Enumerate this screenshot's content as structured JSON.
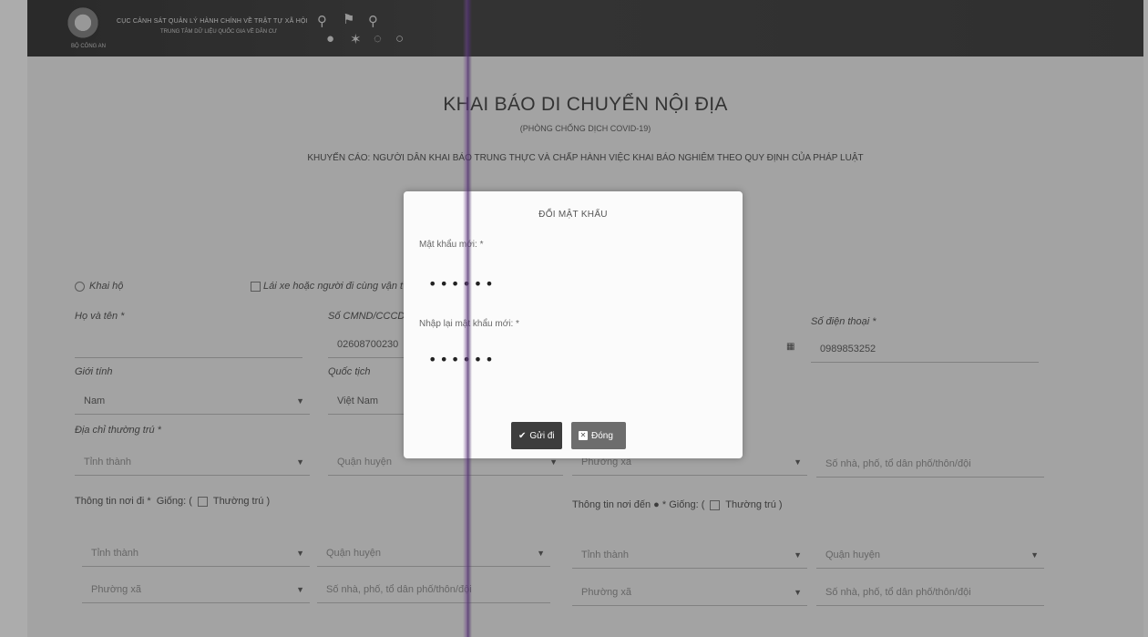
{
  "header": {
    "agency_line": "CỤC CẢNH SÁT QUẢN LÝ HÀNH CHÍNH VỀ TRẬT TỰ XÃ HỘI",
    "center_line": "TRUNG TÂM DỮ LIỆU QUỐC GIA VỀ DÂN CƯ",
    "logo_caption": "BỘ CÔNG AN"
  },
  "page": {
    "title": "KHAI BÁO DI CHUYỂN NỘI ĐỊA",
    "subtitle": "(PHÒNG CHỐNG DỊCH COVID-19)",
    "warning": "KHUYẾN CÁO: NGƯỜI DÂN KHAI BÁO TRUNG THỰC VÀ CHẤP HÀNH VIỆC KHAI BÁO NGHIÊM THEO QUY ĐỊNH CỦA PHÁP LUẬT"
  },
  "form": {
    "khai_ho": "Khai hộ",
    "lai_xe": "Lái xe hoặc người đi cùng vận t",
    "ho_ten_label": "Họ và tên *",
    "cmnd_label": "Số CMND/CCCD",
    "cmnd_value": "02608700230",
    "sdt_label": "Số điện thoại *",
    "sdt_value": "0989853252",
    "gioi_tinh_label": "Giới tính",
    "gioi_tinh_value": "Nam",
    "quoc_tich_label": "Quốc tịch",
    "quoc_tich_value": "Việt Nam",
    "thuong_tru_label": "Địa chỉ thường trú *",
    "tinh_thanh": "Tỉnh thành",
    "quan_huyen": "Quận huyện",
    "phuong_xa": "Phường xã",
    "so_nha": "Số nhà, phố, tổ dân phố/thôn/đội",
    "noi_di_label": "Thông tin nơi đi *",
    "noi_den_label": "Thông tin nơi đến",
    "giong_prefix": "Giống: (",
    "thuong_tru_check": "Thường trú )"
  },
  "modal": {
    "title": "ĐỔI MẬT KHẨU",
    "new_password_label": "Mật khẩu mới: *",
    "new_password_value": "••••••",
    "confirm_label": "Nhập lại mật khẩu mới: *",
    "confirm_value": "••••••",
    "send_button": "Gửi đi",
    "close_button": "Đóng"
  },
  "icons": {
    "send": "check-icon",
    "close": "close-square-icon",
    "calendar": "calendar-icon",
    "select": "caret-down-icon"
  }
}
